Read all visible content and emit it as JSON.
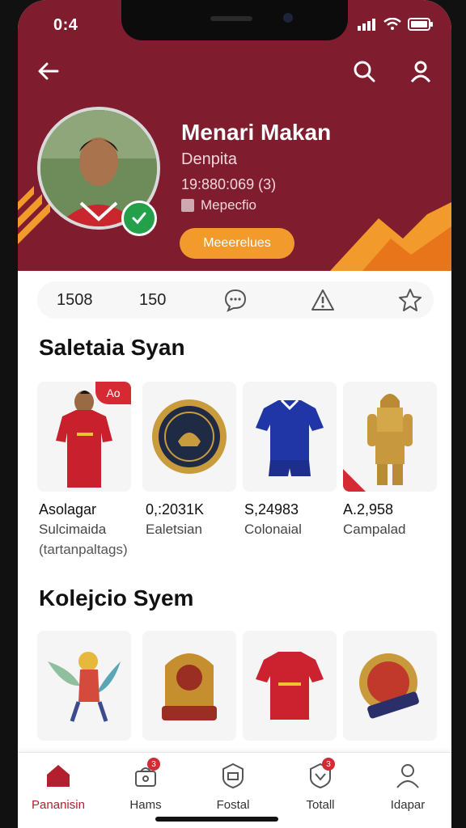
{
  "status_bar": {
    "time": "0:4"
  },
  "profile": {
    "name": "Menari Makan",
    "role": "Denpita",
    "id": "19:880:069 (3)",
    "tag": "Mepecfio",
    "follow_label": "Meeerelues"
  },
  "stats": {
    "first": "1508",
    "second": "150"
  },
  "section1": {
    "title": "Saletaia Syan",
    "items": [
      {
        "name": "jersey-red",
        "price": "Asolagar",
        "sub": "Sulcimaida",
        "sub2": "(tartanpaltags)",
        "badge": "Ao"
      },
      {
        "name": "gold-badge",
        "price": "0,:2031K",
        "sub": "Ealetsian"
      },
      {
        "name": "jersey-blue",
        "price": "S,24983",
        "sub": "Colonaial"
      },
      {
        "name": "gold-armor",
        "price": "A.2,958",
        "sub": "Campalad"
      }
    ]
  },
  "section2": {
    "title": "Kolejcio Syem"
  },
  "nav": [
    {
      "label": "Pananisin",
      "icon": "home-icon",
      "active": true
    },
    {
      "label": "Hams",
      "icon": "bag-icon",
      "badge": "3"
    },
    {
      "label": "Fostal",
      "icon": "shield-icon"
    },
    {
      "label": "Totall",
      "icon": "vote-icon",
      "badge": "3"
    },
    {
      "label": "Idapar",
      "icon": "user-icon"
    }
  ],
  "colors": {
    "header": "#7f1c2e",
    "accent": "#f39a2c",
    "active": "#b21f2f",
    "badge": "#d52a34"
  }
}
